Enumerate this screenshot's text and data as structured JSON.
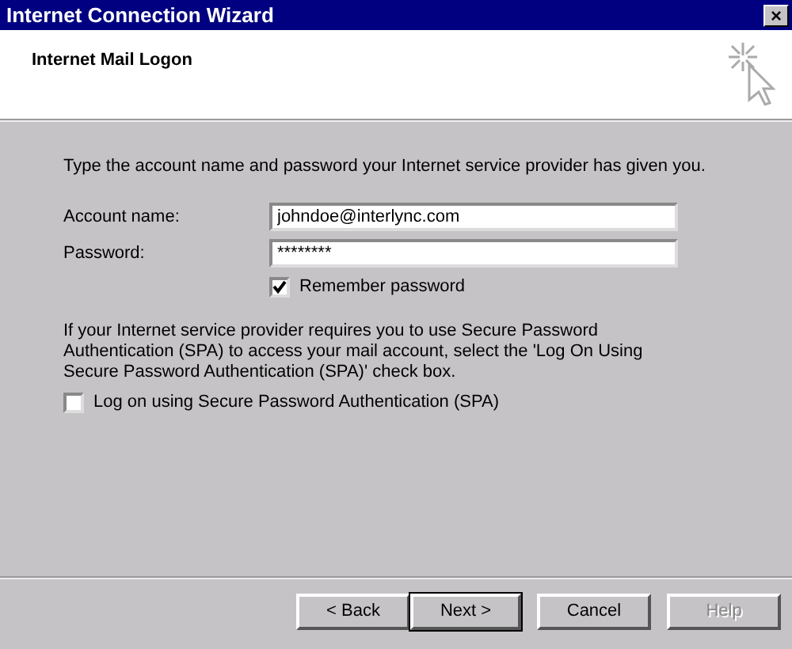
{
  "window": {
    "title": "Internet Connection Wizard",
    "close": "×"
  },
  "header": {
    "title": "Internet Mail Logon"
  },
  "instructions": "Type the account name and password your Internet service provider has given you.",
  "fields": [
    {
      "label": "Account name:",
      "value": "johndoe@interlync.com"
    },
    {
      "label": "Password:",
      "value": "********"
    }
  ],
  "remember": {
    "label": "Remember password",
    "checked": true
  },
  "spa_note": "If your Internet service provider requires you to use Secure Password Authentication (SPA) to access your mail account, select the 'Log On Using Secure Password Authentication (SPA)' check box.",
  "spa": {
    "label": "Log on using Secure Password Authentication (SPA)",
    "checked": false
  },
  "buttons": [
    {
      "label": "< Back",
      "default": false,
      "disabled": false
    },
    {
      "label": "Next >",
      "default": true,
      "disabled": false
    },
    {
      "label": "Cancel",
      "default": false,
      "disabled": false
    },
    {
      "label": "Help",
      "default": false,
      "disabled": true
    }
  ]
}
